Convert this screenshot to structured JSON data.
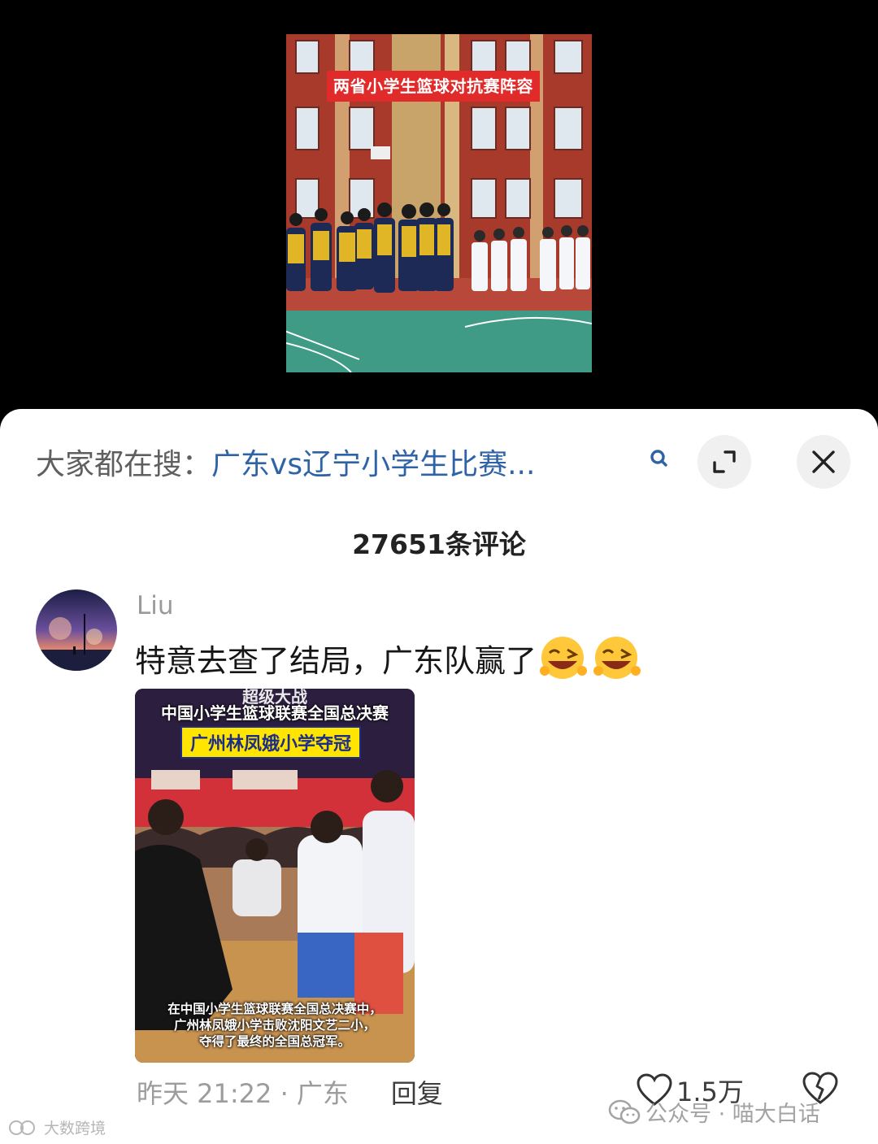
{
  "video": {
    "caption": "两省小学生篮球对抗赛阵容"
  },
  "search": {
    "prefix": "大家都在搜：",
    "query": "广东vs辽宁小学生比赛..."
  },
  "comments_header": {
    "count_label": "27651条评论"
  },
  "comment": {
    "username": "Liu",
    "text": "特意去查了结局，广东队赢了",
    "emojis": [
      "laughing-wink-icon",
      "laughing-wink-icon"
    ],
    "image": {
      "top_line": "超级大战",
      "line1": "中国小学生篮球联赛全国总决赛",
      "line2": "广州林凤娥小学夺冠",
      "footer_lines": [
        "在中国小学生篮球联赛全国总决赛中，",
        "广州林凤娥小学击败沈阳文艺二小，",
        "夺得了最终的全国总冠军。"
      ]
    },
    "timestamp": "昨天 21:22 · 广东",
    "reply_label": "回复",
    "like_count": "1.5万"
  },
  "watermarks": {
    "right": "公众号 · 喵大白话",
    "left": "大数跨境"
  },
  "colors": {
    "search_query": "#2f63a8",
    "caption_bg": "#e12b2b",
    "badge_bg": "#ffe500"
  }
}
